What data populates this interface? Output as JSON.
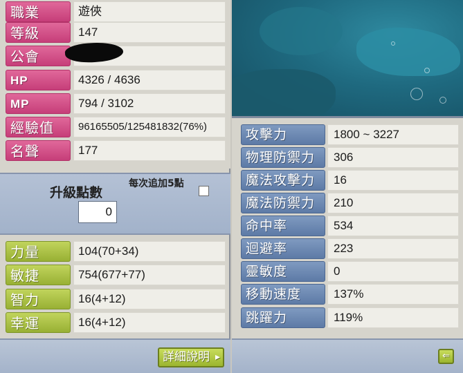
{
  "character": {
    "job": {
      "label": "職業",
      "value": "遊俠"
    },
    "level": {
      "label": "等級",
      "value": "147"
    },
    "guild": {
      "label": "公會",
      "value": ""
    },
    "hp": {
      "label": "HP",
      "value": "4326 / 4636"
    },
    "mp": {
      "label": "MP",
      "value": "794 / 3102"
    },
    "exp": {
      "label": "經驗值",
      "value": "96165505/125481832(76%)"
    },
    "fame": {
      "label": "名聲",
      "value": "177"
    }
  },
  "ability_points": {
    "title": "升級點數",
    "value": "0",
    "per5_label": "每次追加5點",
    "per5_checked": false
  },
  "stats": [
    {
      "label": "力量",
      "value": "104(70+34)"
    },
    {
      "label": "敏捷",
      "value": "754(677+77)"
    },
    {
      "label": "智力",
      "value": "16(4+12)"
    },
    {
      "label": "幸運",
      "value": "16(4+12)"
    }
  ],
  "detail_button": {
    "label": "詳細說明",
    "icon": "chevron-right-icon"
  },
  "combat": [
    {
      "label": "攻擊力",
      "value": "1800 ~ 3227"
    },
    {
      "label": "物理防禦力",
      "value": "306"
    },
    {
      "label": "魔法攻擊力",
      "value": "16"
    },
    {
      "label": "魔法防禦力",
      "value": "210"
    },
    {
      "label": "命中率",
      "value": "534"
    },
    {
      "label": "迴避率",
      "value": "223"
    },
    {
      "label": "靈敏度",
      "value": "0"
    },
    {
      "label": "移動速度",
      "value": "137%"
    },
    {
      "label": "跳躍力",
      "value": "119%"
    }
  ],
  "back_button": {
    "icon": "arrow-left-icon"
  },
  "colors": {
    "pink_label": "#c63e79",
    "green_label": "#98b034",
    "blue_label": "#5d7aa6",
    "panel_bg": "#d6d4cc"
  }
}
